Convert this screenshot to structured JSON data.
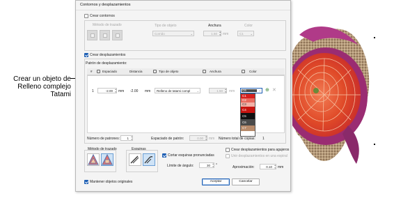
{
  "annotation": {
    "text": "Crear un objeto de Relleno complejo Tatami"
  },
  "dialog": {
    "title": "Contornos y desplazamientos",
    "contours": {
      "checkbox_label": "Crear contornos",
      "method_label": "Método de trazado",
      "object_type_label": "Tipo de objeto",
      "object_type_value": "Corrido",
      "width_label": "Anchura",
      "width_value": "1.50",
      "width_unit": "mm",
      "color_label": "Color",
      "color_value": "C1"
    },
    "offsets": {
      "checkbox_label": "Crear desplazamientos",
      "pattern_label": "Patrón de desplazamiento:",
      "columns": [
        "#",
        "Espaciado",
        "Distancia",
        "Tipo de objeto",
        "Anchura",
        "Color"
      ],
      "row": {
        "num": "1",
        "spacing": "-2.00",
        "spacing_unit": "mm",
        "distance": "-2.00",
        "distance_unit": "mm",
        "object_type": "Relleno de tatami compl",
        "width": "1.50",
        "width_unit": "mm",
        "color": "C6"
      },
      "color_options": [
        {
          "label": "C1",
          "color": "#d8201e"
        },
        {
          "label": "C2",
          "color": "#e86a5e"
        },
        {
          "label": "C3",
          "color": "#f2b0a6"
        },
        {
          "label": "C4",
          "color": "#c81410"
        },
        {
          "label": "C5",
          "color": "#111111"
        },
        {
          "label": "C6",
          "color": "#4a4a4a"
        },
        {
          "label": "C7",
          "color": "#b78a6a"
        }
      ]
    },
    "pattern_count_label": "Número de patrones:",
    "pattern_count_value": "1",
    "pattern_spacing_label": "Espaciado de patrón:",
    "pattern_spacing_value": "0.00",
    "pattern_spacing_unit": "mm",
    "total_copies_label": "Número total de copias:",
    "total_copies_value": "1",
    "trace_method_label": "Método de trazado",
    "corners_label": "Esquinas",
    "cut_corners_label": "Cortar esquinas pronunciadas",
    "angle_limit_label": "Límite de ángulo:",
    "angle_limit_value": "30",
    "angle_unit": "°",
    "create_hole_offsets_label": "Crear desplazamientos para agujeros",
    "join_spiral_label": "Unir desplazamientos en una espiral",
    "approximation_label": "Aproximación:",
    "approximation_value": "0.10",
    "approximation_unit": "mm",
    "keep_originals_label": "Mantener objetos originales",
    "accept_label": "Aceptar",
    "cancel_label": "Cancelar"
  }
}
